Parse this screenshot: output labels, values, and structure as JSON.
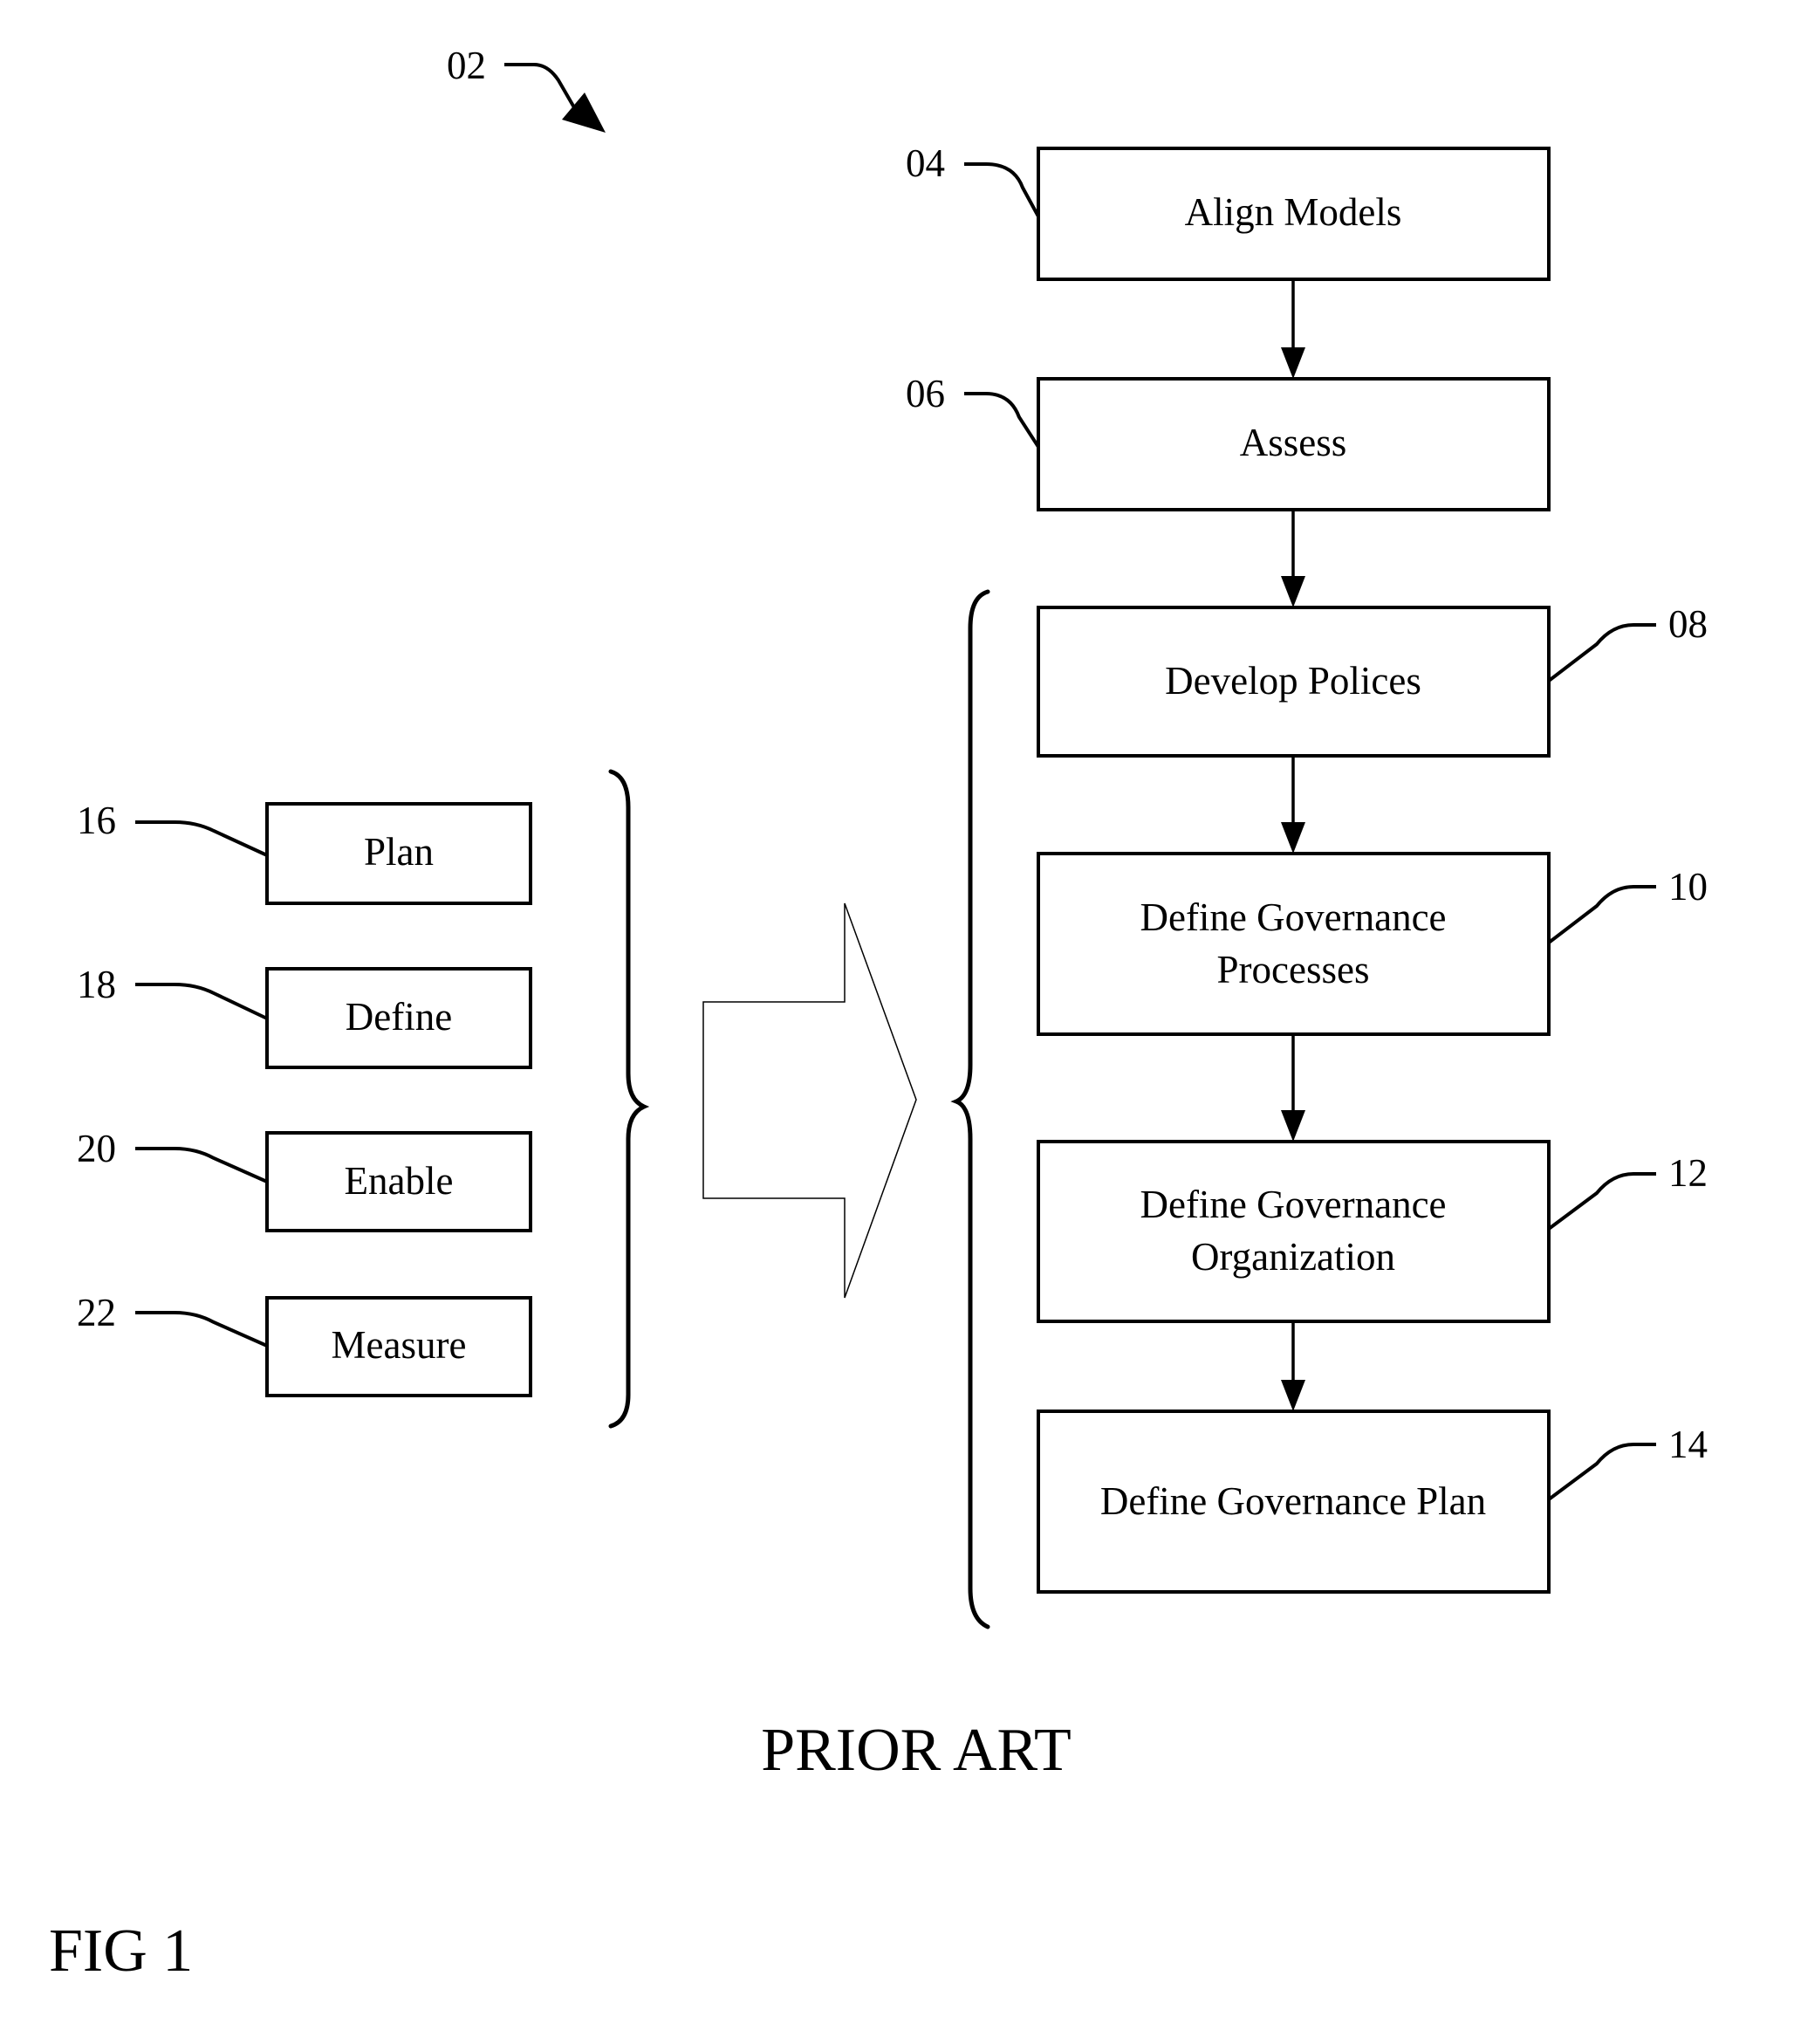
{
  "figure": {
    "ref_overall": "02",
    "caption_prior_art": "PRIOR ART",
    "figure_label": "FIG 1"
  },
  "flow_steps": [
    {
      "ref": "04",
      "lines": [
        "Align Models"
      ]
    },
    {
      "ref": "06",
      "lines": [
        "Assess"
      ]
    },
    {
      "ref": "08",
      "lines": [
        "Develop Polices"
      ]
    },
    {
      "ref": "10",
      "lines": [
        "Define Governance",
        "Processes"
      ]
    },
    {
      "ref": "12",
      "lines": [
        "Define Governance",
        "Organization"
      ]
    },
    {
      "ref": "14",
      "lines": [
        "Define Governance Plan"
      ]
    }
  ],
  "phases": [
    {
      "ref": "16",
      "label": "Plan"
    },
    {
      "ref": "18",
      "label": "Define"
    },
    {
      "ref": "20",
      "label": "Enable"
    },
    {
      "ref": "22",
      "label": "Measure"
    }
  ]
}
